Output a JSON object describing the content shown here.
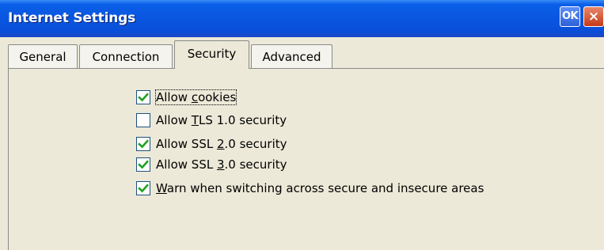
{
  "window": {
    "title": "Internet Settings",
    "ok_label": "OK",
    "close_label": "×",
    "titlebar_color_top": "#0a5fe8",
    "titlebar_color_bottom": "#1b47c6",
    "check_color": "#21a121"
  },
  "tabs": [
    {
      "label": "General",
      "selected": false
    },
    {
      "label": "Connection",
      "selected": false
    },
    {
      "label": "Security",
      "selected": true
    },
    {
      "label": "Advanced",
      "selected": false
    }
  ],
  "security": {
    "options": [
      {
        "pre": "Allow ",
        "mn": "c",
        "post": "ookies",
        "checked": true,
        "focused": true
      },
      {
        "pre": "Allow ",
        "mn": "T",
        "post": "LS 1.0 security",
        "checked": false,
        "focused": false
      },
      {
        "pre": "Allow SSL ",
        "mn": "2",
        "post": ".0 security",
        "checked": true,
        "focused": false
      },
      {
        "pre": "Allow SSL ",
        "mn": "3",
        "post": ".0 security",
        "checked": true,
        "focused": false
      },
      {
        "pre": "",
        "mn": "W",
        "post": "arn when switching across secure and insecure areas",
        "checked": true,
        "focused": false
      }
    ]
  }
}
